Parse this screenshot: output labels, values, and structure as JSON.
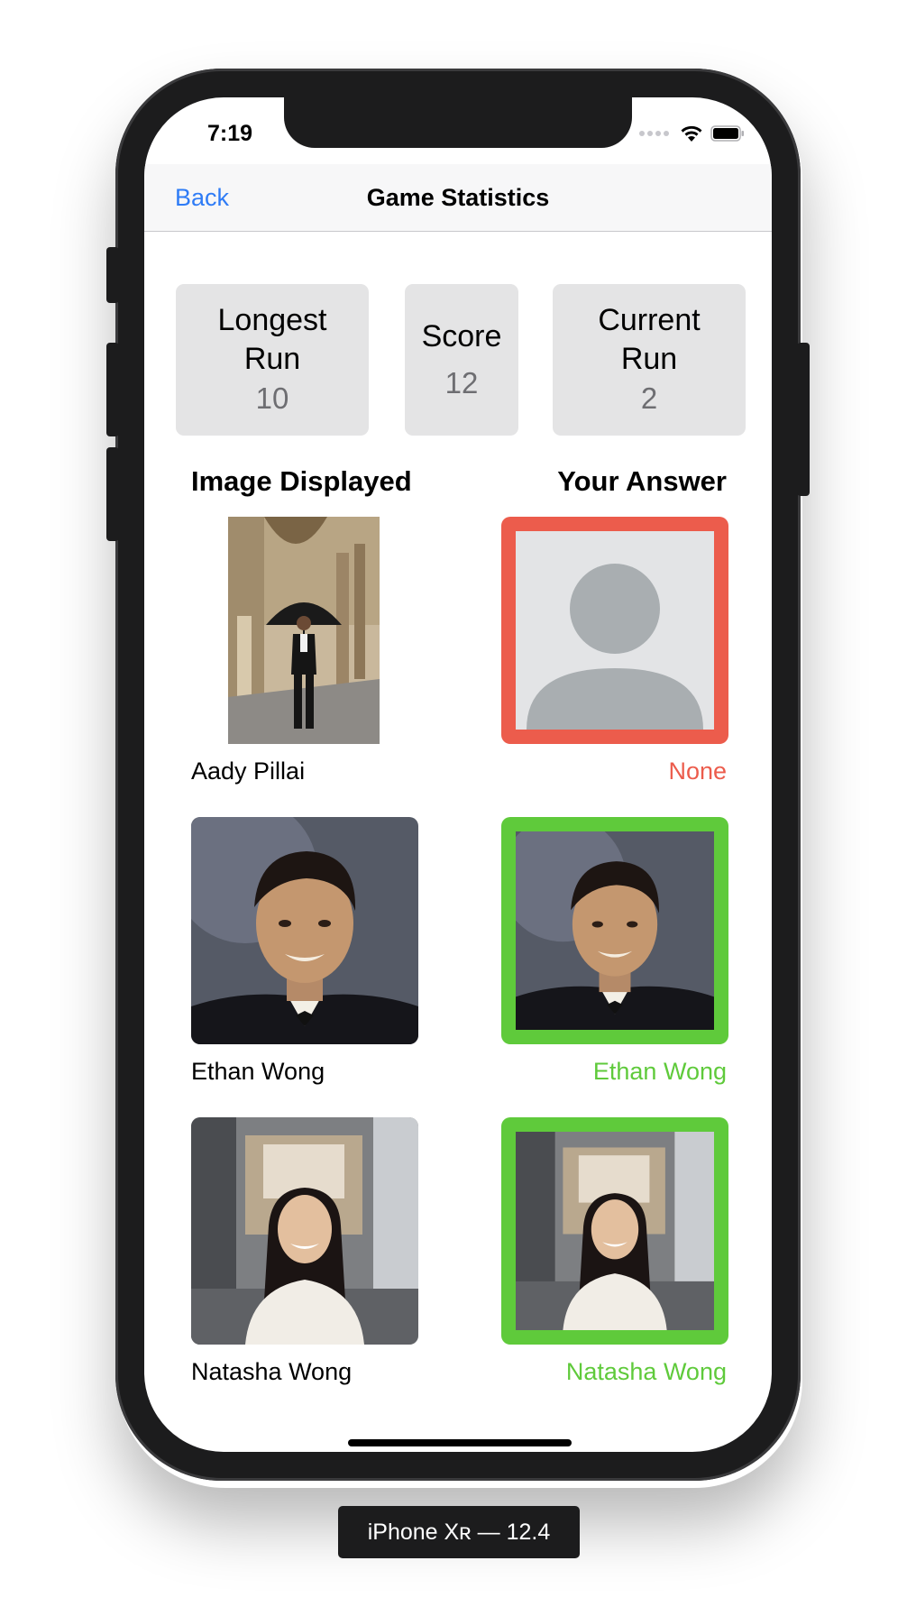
{
  "status_bar": {
    "time": "7:19"
  },
  "nav": {
    "back_label": "Back",
    "title": "Game Statistics"
  },
  "stats": [
    {
      "label_line1": "Longest",
      "label_line2": "Run",
      "value": "10"
    },
    {
      "label_line1": "Score",
      "label_line2": "",
      "value": "12"
    },
    {
      "label_line1": "Current",
      "label_line2": "Run",
      "value": "2"
    }
  ],
  "columns": {
    "left": "Image Displayed",
    "right": "Your Answer"
  },
  "rows": [
    {
      "displayed_name": "Aady Pillai",
      "answer_name": "None",
      "answer_status": "incorrect"
    },
    {
      "displayed_name": "Ethan Wong",
      "answer_name": "Ethan Wong",
      "answer_status": "correct"
    },
    {
      "displayed_name": "Natasha Wong",
      "answer_name": "Natasha Wong",
      "answer_status": "correct"
    }
  ],
  "colors": {
    "accent": "#2f7cf6",
    "incorrect": "#ec5c4c",
    "correct": "#5fca3b",
    "stat_bg": "#e4e4e5"
  },
  "simulator_label": "iPhone Xʀ — 12.4"
}
